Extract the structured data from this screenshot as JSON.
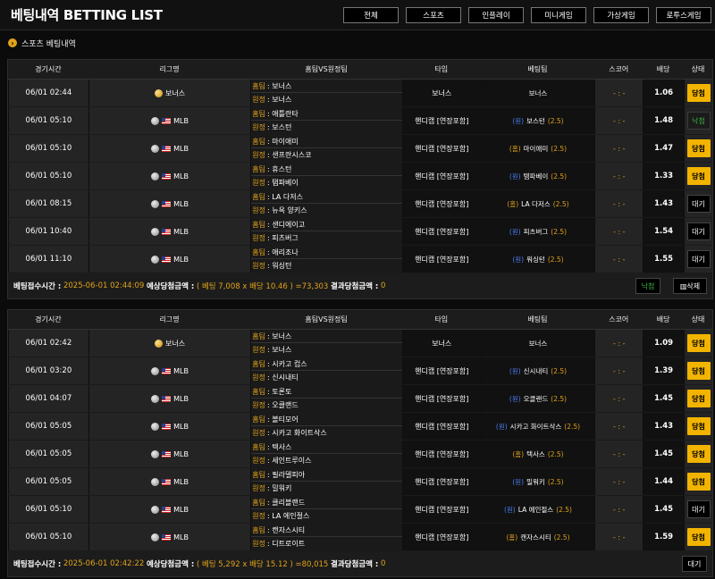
{
  "header": {
    "title": "베팅내역 BETTING LIST"
  },
  "tabs": [
    {
      "label": "전체",
      "w": 64
    },
    {
      "label": "스포츠",
      "w": 64
    },
    {
      "label": "인플레이",
      "w": 64
    },
    {
      "label": "미니게임",
      "w": 64
    },
    {
      "label": "가상게임",
      "w": 64
    },
    {
      "label": "로투스게임",
      "w": 64
    }
  ],
  "subtitle": "스포츠 베팅내역",
  "columns": [
    "경기시간",
    "리그명",
    "홈팀VS원정팀",
    "타입",
    "베팅팀",
    "스코어",
    "배당",
    "상태"
  ],
  "labels": {
    "home_tag": "홈팀",
    "away_tag": "원정",
    "score": "- : -"
  },
  "slips": [
    {
      "footer": {
        "time_label": "베팅접수시간 :",
        "time": "2025-06-01 02:44:09",
        "expected_label": "예상당첨금액 :",
        "expected": "( 베팅 7,008 x 배당 10.46 ) =73,303",
        "result_label": "결과당첨금액 :",
        "result": "0",
        "buttons": [
          {
            "label": "낙첨",
            "kind": "lose"
          },
          {
            "label": "삭제",
            "kind": "delete"
          }
        ]
      },
      "rows": [
        {
          "time": "06/01 02:44",
          "league": "보너스",
          "league_icon": "coin",
          "home": "보너스",
          "away": "보너스",
          "type": "보너스",
          "bet_side": "",
          "bet_team": "보너스",
          "bet_line": "",
          "odds": "1.06",
          "status": "당첨",
          "status_kind": "win"
        },
        {
          "time": "06/01 05:10",
          "league": "MLB",
          "league_icon": "baseball",
          "home": "애틀란타",
          "away": "보스턴",
          "type": "핸디캡 [연장포함]",
          "bet_side": "(원)",
          "bet_team": "보스턴",
          "bet_line": "(2.5)",
          "odds": "1.48",
          "status": "낙첨",
          "status_kind": "lose"
        },
        {
          "time": "06/01 05:10",
          "league": "MLB",
          "league_icon": "baseball",
          "home": "마이애미",
          "away": "샌프란시스코",
          "type": "핸디캡 [연장포함]",
          "bet_side": "(홈)",
          "bet_team": "마이애미",
          "bet_line": "(2.5)",
          "odds": "1.47",
          "status": "당첨",
          "status_kind": "win"
        },
        {
          "time": "06/01 05:10",
          "league": "MLB",
          "league_icon": "baseball",
          "home": "휴스턴",
          "away": "탬파베이",
          "type": "핸디캡 [연장포함]",
          "bet_side": "(원)",
          "bet_team": "탬파베이",
          "bet_line": "(2.5)",
          "odds": "1.33",
          "status": "당첨",
          "status_kind": "win"
        },
        {
          "time": "06/01 08:15",
          "league": "MLB",
          "league_icon": "baseball",
          "home": "LA 다저스",
          "away": "뉴욕 양키스",
          "type": "핸디캡 [연장포함]",
          "bet_side": "(홈)",
          "bet_team": "LA 다저스",
          "bet_line": "(2.5)",
          "odds": "1.43",
          "status": "대기",
          "status_kind": "wait"
        },
        {
          "time": "06/01 10:40",
          "league": "MLB",
          "league_icon": "baseball",
          "home": "샌디에이고",
          "away": "피츠버그",
          "type": "핸디캡 [연장포함]",
          "bet_side": "(원)",
          "bet_team": "피츠버그",
          "bet_line": "(2.5)",
          "odds": "1.54",
          "status": "대기",
          "status_kind": "wait"
        },
        {
          "time": "06/01 11:10",
          "league": "MLB",
          "league_icon": "baseball",
          "home": "애리조나",
          "away": "워싱턴",
          "type": "핸디캡 [연장포함]",
          "bet_side": "(원)",
          "bet_team": "워싱턴",
          "bet_line": "(2.5)",
          "odds": "1.55",
          "status": "대기",
          "status_kind": "wait"
        }
      ]
    },
    {
      "footer": {
        "time_label": "베팅접수시간 :",
        "time": "2025-06-01 02:42:22",
        "expected_label": "예상당첨금액 :",
        "expected": "( 베팅 5,292 x 배당 15.12 ) =80,015",
        "result_label": "결과당첨금액 :",
        "result": "0",
        "buttons": [
          {
            "label": "대기",
            "kind": "wait"
          }
        ]
      },
      "rows": [
        {
          "time": "06/01 02:42",
          "league": "보너스",
          "league_icon": "coin",
          "home": "보너스",
          "away": "보너스",
          "type": "보너스",
          "bet_side": "",
          "bet_team": "보너스",
          "bet_line": "",
          "odds": "1.09",
          "status": "당첨",
          "status_kind": "win"
        },
        {
          "time": "06/01 03:20",
          "league": "MLB",
          "league_icon": "baseball",
          "home": "시카고 컵스",
          "away": "신시내티",
          "type": "핸디캡 [연장포함]",
          "bet_side": "(원)",
          "bet_team": "신시내티",
          "bet_line": "(2.5)",
          "odds": "1.39",
          "status": "당첨",
          "status_kind": "win"
        },
        {
          "time": "06/01 04:07",
          "league": "MLB",
          "league_icon": "baseball",
          "home": "토론토",
          "away": "오클랜드",
          "type": "핸디캡 [연장포함]",
          "bet_side": "(원)",
          "bet_team": "오클랜드",
          "bet_line": "(2.5)",
          "odds": "1.45",
          "status": "당첨",
          "status_kind": "win"
        },
        {
          "time": "06/01 05:05",
          "league": "MLB",
          "league_icon": "baseball",
          "home": "볼티모어",
          "away": "시카고 화이트삭스",
          "type": "핸디캡 [연장포함]",
          "bet_side": "(원)",
          "bet_team": "시카고 화이트삭스",
          "bet_line": "(2.5)",
          "odds": "1.43",
          "status": "당첨",
          "status_kind": "win"
        },
        {
          "time": "06/01 05:05",
          "league": "MLB",
          "league_icon": "baseball",
          "home": "텍사스",
          "away": "세인트루이스",
          "type": "핸디캡 [연장포함]",
          "bet_side": "(홈)",
          "bet_team": "텍사스",
          "bet_line": "(2.5)",
          "odds": "1.45",
          "status": "당첨",
          "status_kind": "win"
        },
        {
          "time": "06/01 05:05",
          "league": "MLB",
          "league_icon": "baseball",
          "home": "필라델피아",
          "away": "밀워키",
          "type": "핸디캡 [연장포함]",
          "bet_side": "(원)",
          "bet_team": "밀워키",
          "bet_line": "(2.5)",
          "odds": "1.44",
          "status": "당첨",
          "status_kind": "win"
        },
        {
          "time": "06/01 05:10",
          "league": "MLB",
          "league_icon": "baseball",
          "home": "클리블랜드",
          "away": "LA 에인절스",
          "type": "핸디캡 [연장포함]",
          "bet_side": "(원)",
          "bet_team": "LA 에인절스",
          "bet_line": "(2.5)",
          "odds": "1.45",
          "status": "대기",
          "status_kind": "wait"
        },
        {
          "time": "06/01 05:10",
          "league": "MLB",
          "league_icon": "baseball",
          "home": "캔자스시티",
          "away": "디트로이트",
          "type": "핸디캡 [연장포함]",
          "bet_side": "(홈)",
          "bet_team": "캔자스시티",
          "bet_line": "(2.5)",
          "odds": "1.59",
          "status": "당첨",
          "status_kind": "win"
        }
      ]
    }
  ]
}
